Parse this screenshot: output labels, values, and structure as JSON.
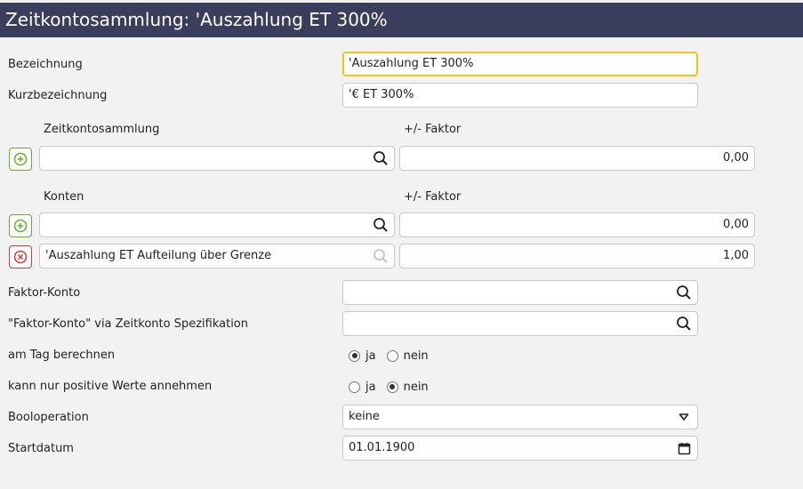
{
  "window": {
    "title": "Zeitkontosammlung: 'Auszahlung ET 300%"
  },
  "form": {
    "bezeichnung": {
      "label": "Bezeichnung",
      "value": "'Auszahlung ET 300%"
    },
    "kurzbezeichnung": {
      "label": "Kurzbezeichnung",
      "value": "'€ ET 300%"
    },
    "zeitkontosammlung_section": {
      "col1": "Zeitkontosammlung",
      "col2": "+/- Faktor",
      "rows": [
        {
          "value": "",
          "faktor": "0,00"
        }
      ]
    },
    "konten_section": {
      "col1": "Konten",
      "col2": "+/- Faktor",
      "rows": [
        {
          "value": "",
          "faktor": "0,00"
        },
        {
          "value": "'Auszahlung ET Aufteilung über Grenze",
          "faktor": "1,00"
        }
      ]
    },
    "faktor_konto": {
      "label": "Faktor-Konto",
      "value": ""
    },
    "faktor_konto_spez": {
      "label": "\"Faktor-Konto\" via Zeitkonto Spezifikation",
      "value": ""
    },
    "am_tag_berechnen": {
      "label": "am Tag berechnen",
      "options": [
        "ja",
        "nein"
      ],
      "selected": "ja"
    },
    "nur_positive": {
      "label": "kann nur positive Werte annehmen",
      "options": [
        "ja",
        "nein"
      ],
      "selected": "nein"
    },
    "booloperation": {
      "label": "Booloperation",
      "value": "keine"
    },
    "startdatum": {
      "label": "Startdatum",
      "value": "01.01.1900"
    }
  },
  "icons": {
    "search": "search-icon",
    "add": "plus-circle-icon",
    "remove": "x-circle-icon",
    "dropdown": "caret-down-icon",
    "calendar": "calendar-icon"
  },
  "colors": {
    "titlebar": "#3b3d5c",
    "focus_border": "#f0c419",
    "add_green": "#6aaa3a",
    "remove_red": "#d03b3b"
  }
}
